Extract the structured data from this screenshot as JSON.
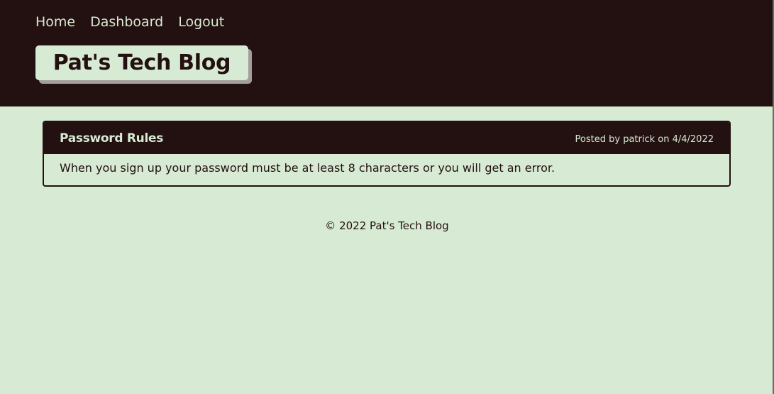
{
  "nav": {
    "items": [
      {
        "label": "Home"
      },
      {
        "label": "Dashboard"
      },
      {
        "label": "Logout"
      }
    ]
  },
  "header": {
    "title": "Pat's Tech Blog"
  },
  "post": {
    "title": "Password Rules",
    "meta": "Posted by patrick on 4/4/2022",
    "body": "When you sign up your password must be at least 8 characters or you will get an error."
  },
  "footer": {
    "text": "© 2022 Pat's Tech Blog"
  },
  "colors": {
    "dark": "#231010",
    "light": "#d7ead3",
    "shadow": "#a39e9e"
  }
}
